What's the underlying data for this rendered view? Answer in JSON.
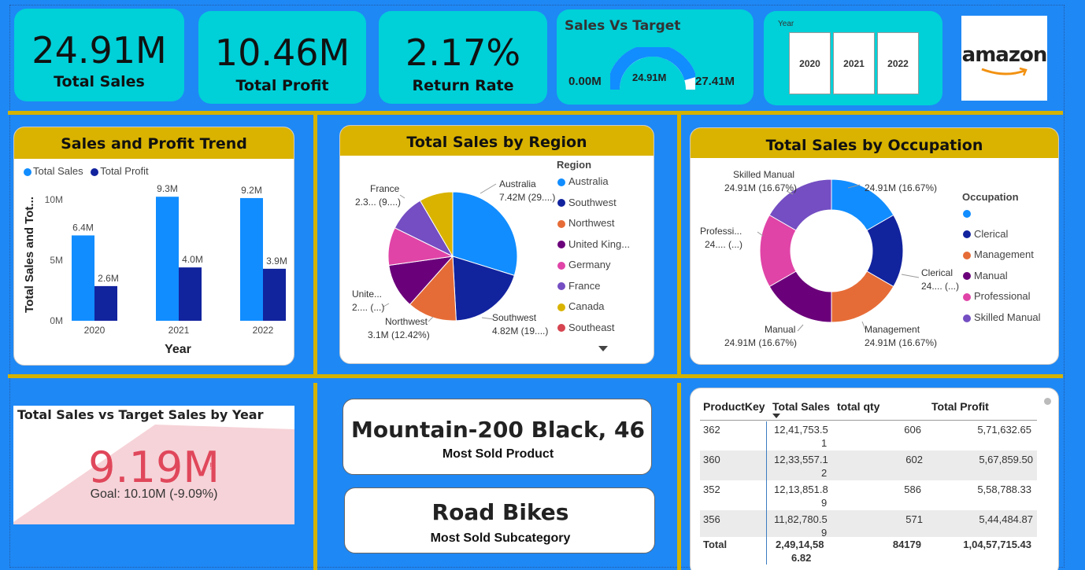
{
  "kpis": {
    "total_sales": {
      "value": "24.91M",
      "label": "Total Sales"
    },
    "total_profit": {
      "value": "10.46M",
      "label": "Total Profit"
    },
    "return_rate": {
      "value": "2.17%",
      "label": "Return Rate"
    }
  },
  "gauge": {
    "title": "Sales Vs Target",
    "min": "0.00M",
    "value": "24.91M",
    "max": "27.41M",
    "fill_fraction": 0.909
  },
  "year_slicer": {
    "label": "Year",
    "options": [
      "2020",
      "2021",
      "2022"
    ]
  },
  "logo": {
    "text": "amazon"
  },
  "trend": {
    "title": "Sales and Profit Trend",
    "legend": [
      "Total Sales",
      "Total Profit"
    ],
    "ylabel": "Total Sales and Tot...",
    "xlabel": "Year",
    "yticks": [
      "10M",
      "5M",
      "0M"
    ]
  },
  "region": {
    "title": "Total Sales by Region",
    "legend_title": "Region",
    "legend": [
      "Australia",
      "Southwest",
      "Northwest",
      "United King...",
      "Germany",
      "France",
      "Canada",
      "Southeast"
    ],
    "labels": {
      "australia": [
        "Australia",
        "7.42M (29....)"
      ],
      "southwest": [
        "Southwest",
        "4.82M (19....)"
      ],
      "northwest": [
        "Northwest",
        "3.1M (12.42%)"
      ],
      "united": [
        "Unite...",
        "2.... (...)"
      ],
      "france": [
        "France",
        "2.3... (9....)"
      ]
    }
  },
  "occupation": {
    "title": "Total Sales by Occupation",
    "legend_title": "Occupation",
    "legend": [
      "",
      "Clerical",
      "Management",
      "Manual",
      "Professional",
      "Skilled Manual"
    ],
    "labels": {
      "skilled": [
        "Skilled Manual",
        "24.91M (16.67%)"
      ],
      "blank": [
        "24.91M (16.67%)"
      ],
      "profess": [
        "Professi...",
        "24.... (...)"
      ],
      "clerical": [
        "Clerical",
        "24.... (...)"
      ],
      "manual": [
        "Manual",
        "24.91M (16.67%)"
      ],
      "management": [
        "Management",
        "24.91M (16.67%)"
      ]
    }
  },
  "target_card": {
    "title": "Total Sales vs Target Sales by Year",
    "value": "9.19M",
    "goal": "Goal: 10.10M (-9.09%)",
    "warn": "!"
  },
  "most_sold_product": {
    "value": "Mountain-200 Black, 46",
    "label": "Most Sold Product"
  },
  "most_sold_subcategory": {
    "value": "Road Bikes",
    "label": "Most Sold Subcategory"
  },
  "table": {
    "headers": [
      "ProductKey",
      "Total Sales",
      "total qty",
      "Total Profit"
    ],
    "rows": [
      {
        "key": "362",
        "sales1": "12,41,753.5",
        "sales2": "1",
        "qty": "606",
        "profit": "5,71,632.65"
      },
      {
        "key": "360",
        "sales1": "12,33,557.1",
        "sales2": "2",
        "qty": "602",
        "profit": "5,67,859.50"
      },
      {
        "key": "352",
        "sales1": "12,13,851.8",
        "sales2": "9",
        "qty": "586",
        "profit": "5,58,788.33"
      },
      {
        "key": "356",
        "sales1": "11,82,780.5",
        "sales2": "9",
        "qty": "571",
        "profit": "5,44,484.87"
      }
    ],
    "total": {
      "label": "Total",
      "sales1": "2,49,14,58",
      "sales2": "6.82",
      "qty": "84179",
      "profit": "1,04,57,715.43"
    }
  },
  "chart_data": [
    {
      "type": "bar",
      "title": "Sales and Profit Trend",
      "xlabel": "Year",
      "ylabel": "Total Sales and Tot...",
      "categories": [
        "2020",
        "2021",
        "2022"
      ],
      "series": [
        {
          "name": "Total Sales",
          "values": [
            6.4,
            9.3,
            9.2
          ],
          "labels": [
            "6.4M",
            "9.3M",
            "9.2M"
          ],
          "color": "#118dff"
        },
        {
          "name": "Total Profit",
          "values": [
            2.6,
            4.0,
            3.9
          ],
          "labels": [
            "2.6M",
            "4.0M",
            "3.9M"
          ],
          "color": "#12239e"
        }
      ],
      "ylim": [
        0,
        11.2
      ]
    },
    {
      "type": "pie",
      "title": "Total Sales by Region",
      "slices": [
        {
          "name": "Australia",
          "value": 29.8,
          "color": "#118dff"
        },
        {
          "name": "Southwest",
          "value": 19.35,
          "color": "#12239e"
        },
        {
          "name": "Northwest",
          "value": 12.42,
          "color": "#e66c37"
        },
        {
          "name": "United Kingdom",
          "value": 11.2,
          "color": "#6b007b"
        },
        {
          "name": "Germany",
          "value": 9.5,
          "color": "#e044a7"
        },
        {
          "name": "France",
          "value": 9.3,
          "color": "#744ec2"
        },
        {
          "name": "Canada",
          "value": 8.43,
          "color": "#d9b300"
        }
      ]
    },
    {
      "type": "pie",
      "title": "Total Sales by Occupation",
      "donut": true,
      "slices": [
        {
          "name": "",
          "value": 16.67,
          "color": "#118dff"
        },
        {
          "name": "Clerical",
          "value": 16.67,
          "color": "#12239e"
        },
        {
          "name": "Management",
          "value": 16.67,
          "color": "#e66c37"
        },
        {
          "name": "Manual",
          "value": 16.67,
          "color": "#6b007b"
        },
        {
          "name": "Professional",
          "value": 16.67,
          "color": "#e044a7"
        },
        {
          "name": "Skilled Manual",
          "value": 16.67,
          "color": "#744ec2"
        }
      ]
    }
  ],
  "colors": {
    "background": "#1e88f5",
    "kpi": "#00d0d8",
    "header": "#d9b300",
    "legend_southeast": "#d64550",
    "target_value": "#e0475b"
  }
}
